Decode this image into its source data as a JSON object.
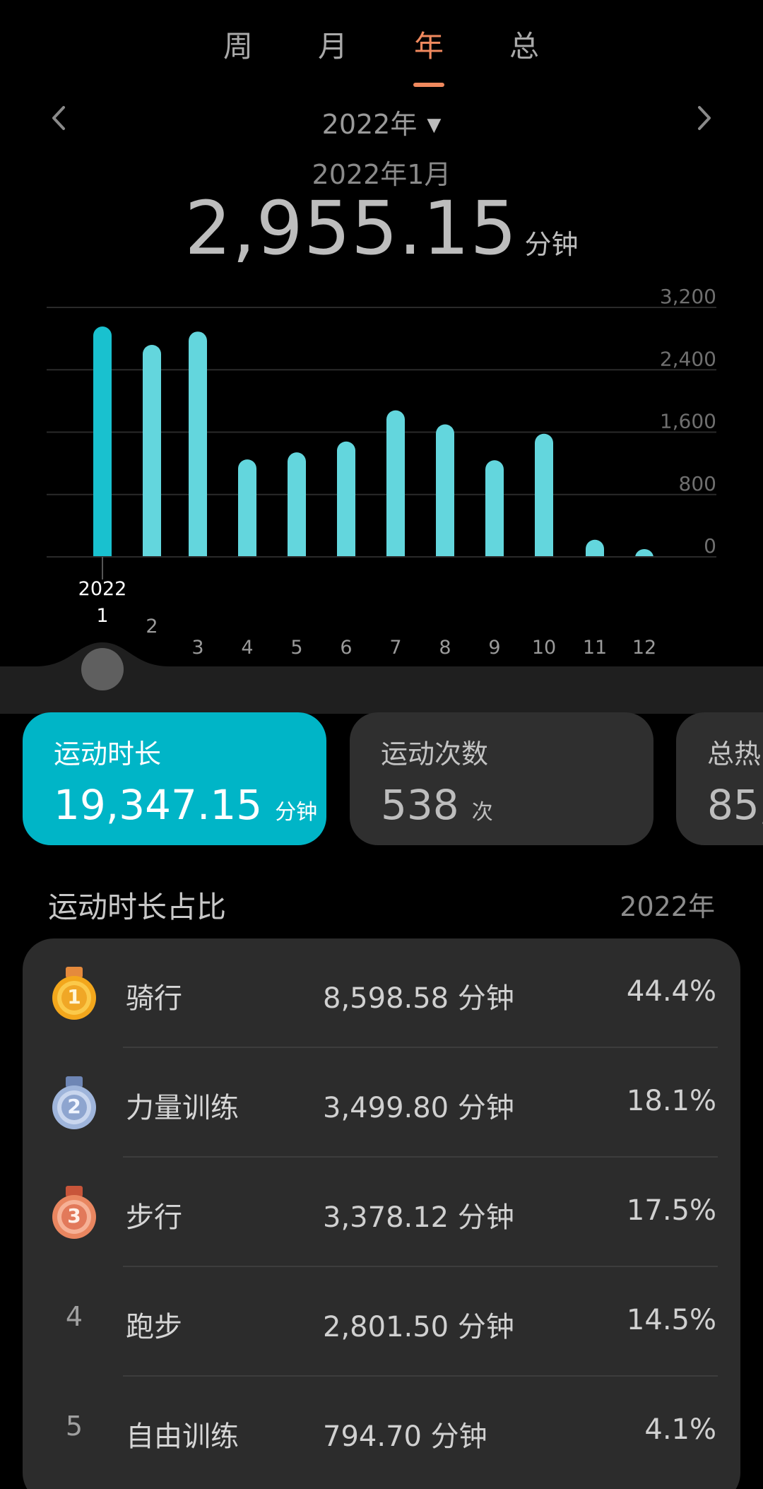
{
  "tabs": [
    "周",
    "月",
    "年",
    "总"
  ],
  "active_tab": 2,
  "selector": {
    "year_label": "2022年",
    "selected_period": "2022年1月",
    "value": "2,955.15",
    "unit": "分钟"
  },
  "colors": {
    "accent": "#f0895e",
    "bar": "#63d6dd",
    "bar_selected": "#19c1cf",
    "card_active": "#00b5c7",
    "grid": "#2a2a2a"
  },
  "chart_data": {
    "type": "bar",
    "categories": [
      "1",
      "2",
      "3",
      "4",
      "5",
      "6",
      "7",
      "8",
      "9",
      "10",
      "11",
      "12"
    ],
    "values": [
      2955.15,
      2720,
      2890,
      1250,
      1340,
      1480,
      1880,
      1700,
      1240,
      1580,
      220,
      100
    ],
    "y_ticks": [
      "0",
      "800",
      "1,600",
      "2,400",
      "3,200"
    ],
    "ylim": [
      0,
      3200
    ],
    "selected_index": 0,
    "selected_year_label": "2022",
    "grid": true,
    "axis_position": "right"
  },
  "cards": [
    {
      "label": "运动时长",
      "value": "19,347.15",
      "unit": "分钟"
    },
    {
      "label": "运动次数",
      "value": "538",
      "unit": "次"
    },
    {
      "label": "总热",
      "value": "85,",
      "unit": ""
    }
  ],
  "ranking": {
    "title": "运动时长占比",
    "year": "2022年",
    "items": [
      {
        "rank": "1",
        "medal": "gold-medal-icon",
        "name": "骑行",
        "duration": "8,598.58 分钟",
        "percent": "44.4%"
      },
      {
        "rank": "2",
        "medal": "silver-medal-icon",
        "name": "力量训练",
        "duration": "3,499.80 分钟",
        "percent": "18.1%"
      },
      {
        "rank": "3",
        "medal": "bronze-medal-icon",
        "name": "步行",
        "duration": "3,378.12 分钟",
        "percent": "17.5%"
      },
      {
        "rank": "4",
        "medal": "",
        "name": "跑步",
        "duration": "2,801.50 分钟",
        "percent": "14.5%"
      },
      {
        "rank": "5",
        "medal": "",
        "name": "自由训练",
        "duration": "794.70 分钟",
        "percent": "4.1%"
      }
    ]
  }
}
